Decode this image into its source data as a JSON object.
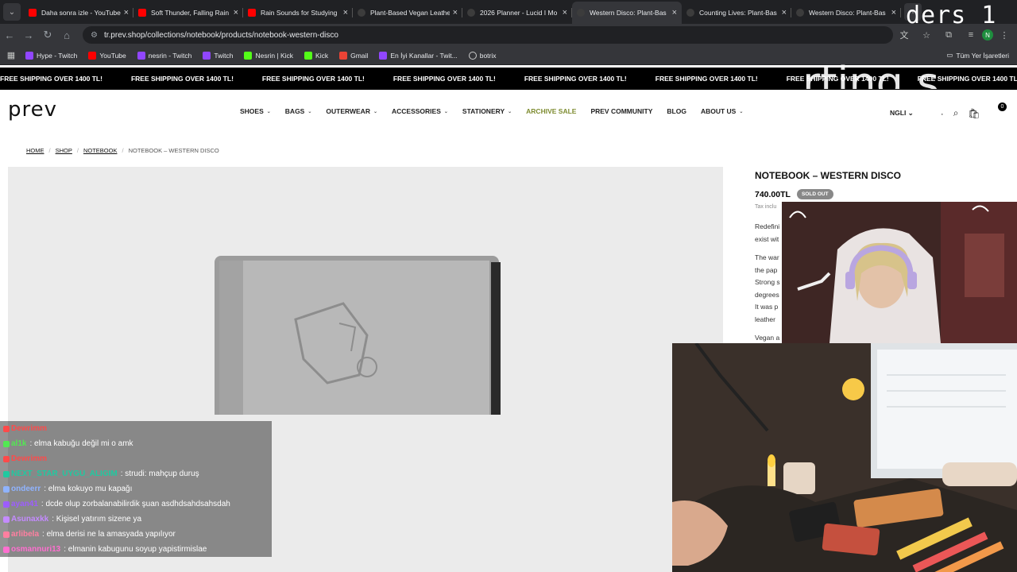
{
  "browser": {
    "tabs": [
      {
        "title": "Daha sonra izle - YouTube",
        "icon": "youtube-icon",
        "active": false
      },
      {
        "title": "Soft Thunder, Falling Rain",
        "icon": "youtube-icon",
        "active": false
      },
      {
        "title": "Rain Sounds for Studying",
        "icon": "youtube-icon",
        "active": false
      },
      {
        "title": "Plant-Based Vegan Leathe",
        "icon": "site-icon",
        "active": false
      },
      {
        "title": "2026 Planner - Lucid I Mo",
        "icon": "site-icon",
        "active": false
      },
      {
        "title": "Western Disco: Plant-Bas",
        "icon": "site-icon",
        "active": true
      },
      {
        "title": "Counting Lives: Plant-Bas",
        "icon": "site-icon",
        "active": false
      },
      {
        "title": "Western Disco: Plant-Bas",
        "icon": "site-icon",
        "active": false
      }
    ],
    "url": "tr.prev.shop/collections/notebook/products/notebook-western-disco",
    "bookmarks": [
      {
        "label": "Hype - Twitch",
        "color": "purple"
      },
      {
        "label": "YouTube",
        "color": "red"
      },
      {
        "label": "nesrin - Twitch",
        "color": "purple"
      },
      {
        "label": "Twitch",
        "color": "purple"
      },
      {
        "label": "Nesrin | Kick",
        "color": "green"
      },
      {
        "label": "Kick",
        "color": "green"
      },
      {
        "label": "Gmail",
        "color": "gm"
      },
      {
        "label": "En İyi Kanallar - Twit...",
        "color": "purple"
      },
      {
        "label": "botrix",
        "color": "none"
      }
    ],
    "all_bookmarks": "Tüm Yer İşaretleri",
    "profile_initial": "N"
  },
  "site": {
    "shipping_banner": "FREE SHIPPING OVER 1400 TL!",
    "logo": "prev",
    "nav": [
      {
        "label": "SHOES",
        "caret": true
      },
      {
        "label": "BAGS",
        "caret": true
      },
      {
        "label": "OUTERWEAR",
        "caret": true
      },
      {
        "label": "ACCESSORIES",
        "caret": true
      },
      {
        "label": "STATIONERY",
        "caret": true
      },
      {
        "label": "ARCHIVE SALE",
        "caret": false
      },
      {
        "label": "PREV COMMUNITY",
        "caret": false
      },
      {
        "label": "BLOG",
        "caret": false
      },
      {
        "label": "ABOUT US",
        "caret": true
      }
    ],
    "language": "NGLI",
    "cart_count": "0",
    "breadcrumb": [
      "HOME",
      "SHOP",
      "NOTEBOOK",
      "NOTEBOOK – WESTERN DISCO"
    ]
  },
  "product": {
    "title": "NOTEBOOK – WESTERN DISCO",
    "price": "740.00TL",
    "badge": "SOLD OUT",
    "tax_note": "Tax inclu",
    "desc1": [
      "Redefini",
      "exist wit"
    ],
    "desc2": [
      "The war",
      "the pap",
      "Strong s",
      "degrees",
      "It was p",
      "leather"
    ],
    "desc3": "Vegan a"
  },
  "overlay": {
    "corner_text": "ders 1",
    "ghost_text": "rting s"
  },
  "chat": [
    {
      "user": "Dewrimm",
      "msg": "",
      "color": "#ff4a4a"
    },
    {
      "user": "al1k",
      "msg": ": elma kabuğu değil mi o amk",
      "color": "#52e852"
    },
    {
      "user": "Dewrimm",
      "msg": "",
      "color": "#ff4a4a"
    },
    {
      "user": "NEXT_STAR_UYGU_ALIGIM",
      "msg": ": strudi: mahçup duruş",
      "color": "#20c9a0"
    },
    {
      "user": "ondeerr",
      "msg": ": elma kokuyo mu kapağı",
      "color": "#8fb3ff"
    },
    {
      "user": "ayan41",
      "msg": ": dcde olup zorbalanabilirdik şuan asdhdsahdsahsdah",
      "color": "#9d5cff"
    },
    {
      "user": "Asunaxkk",
      "msg": ": Kişisel yatırım sizene ya",
      "color": "#c48bff"
    },
    {
      "user": "arlibela",
      "msg": ": elma derisi ne la amasyada yapılıyor",
      "color": "#ff7fa0"
    },
    {
      "user": "osmannuri13",
      "msg": ": elmanin kabugunu soyup yapistirmislae",
      "color": "#ff6fd0"
    }
  ]
}
